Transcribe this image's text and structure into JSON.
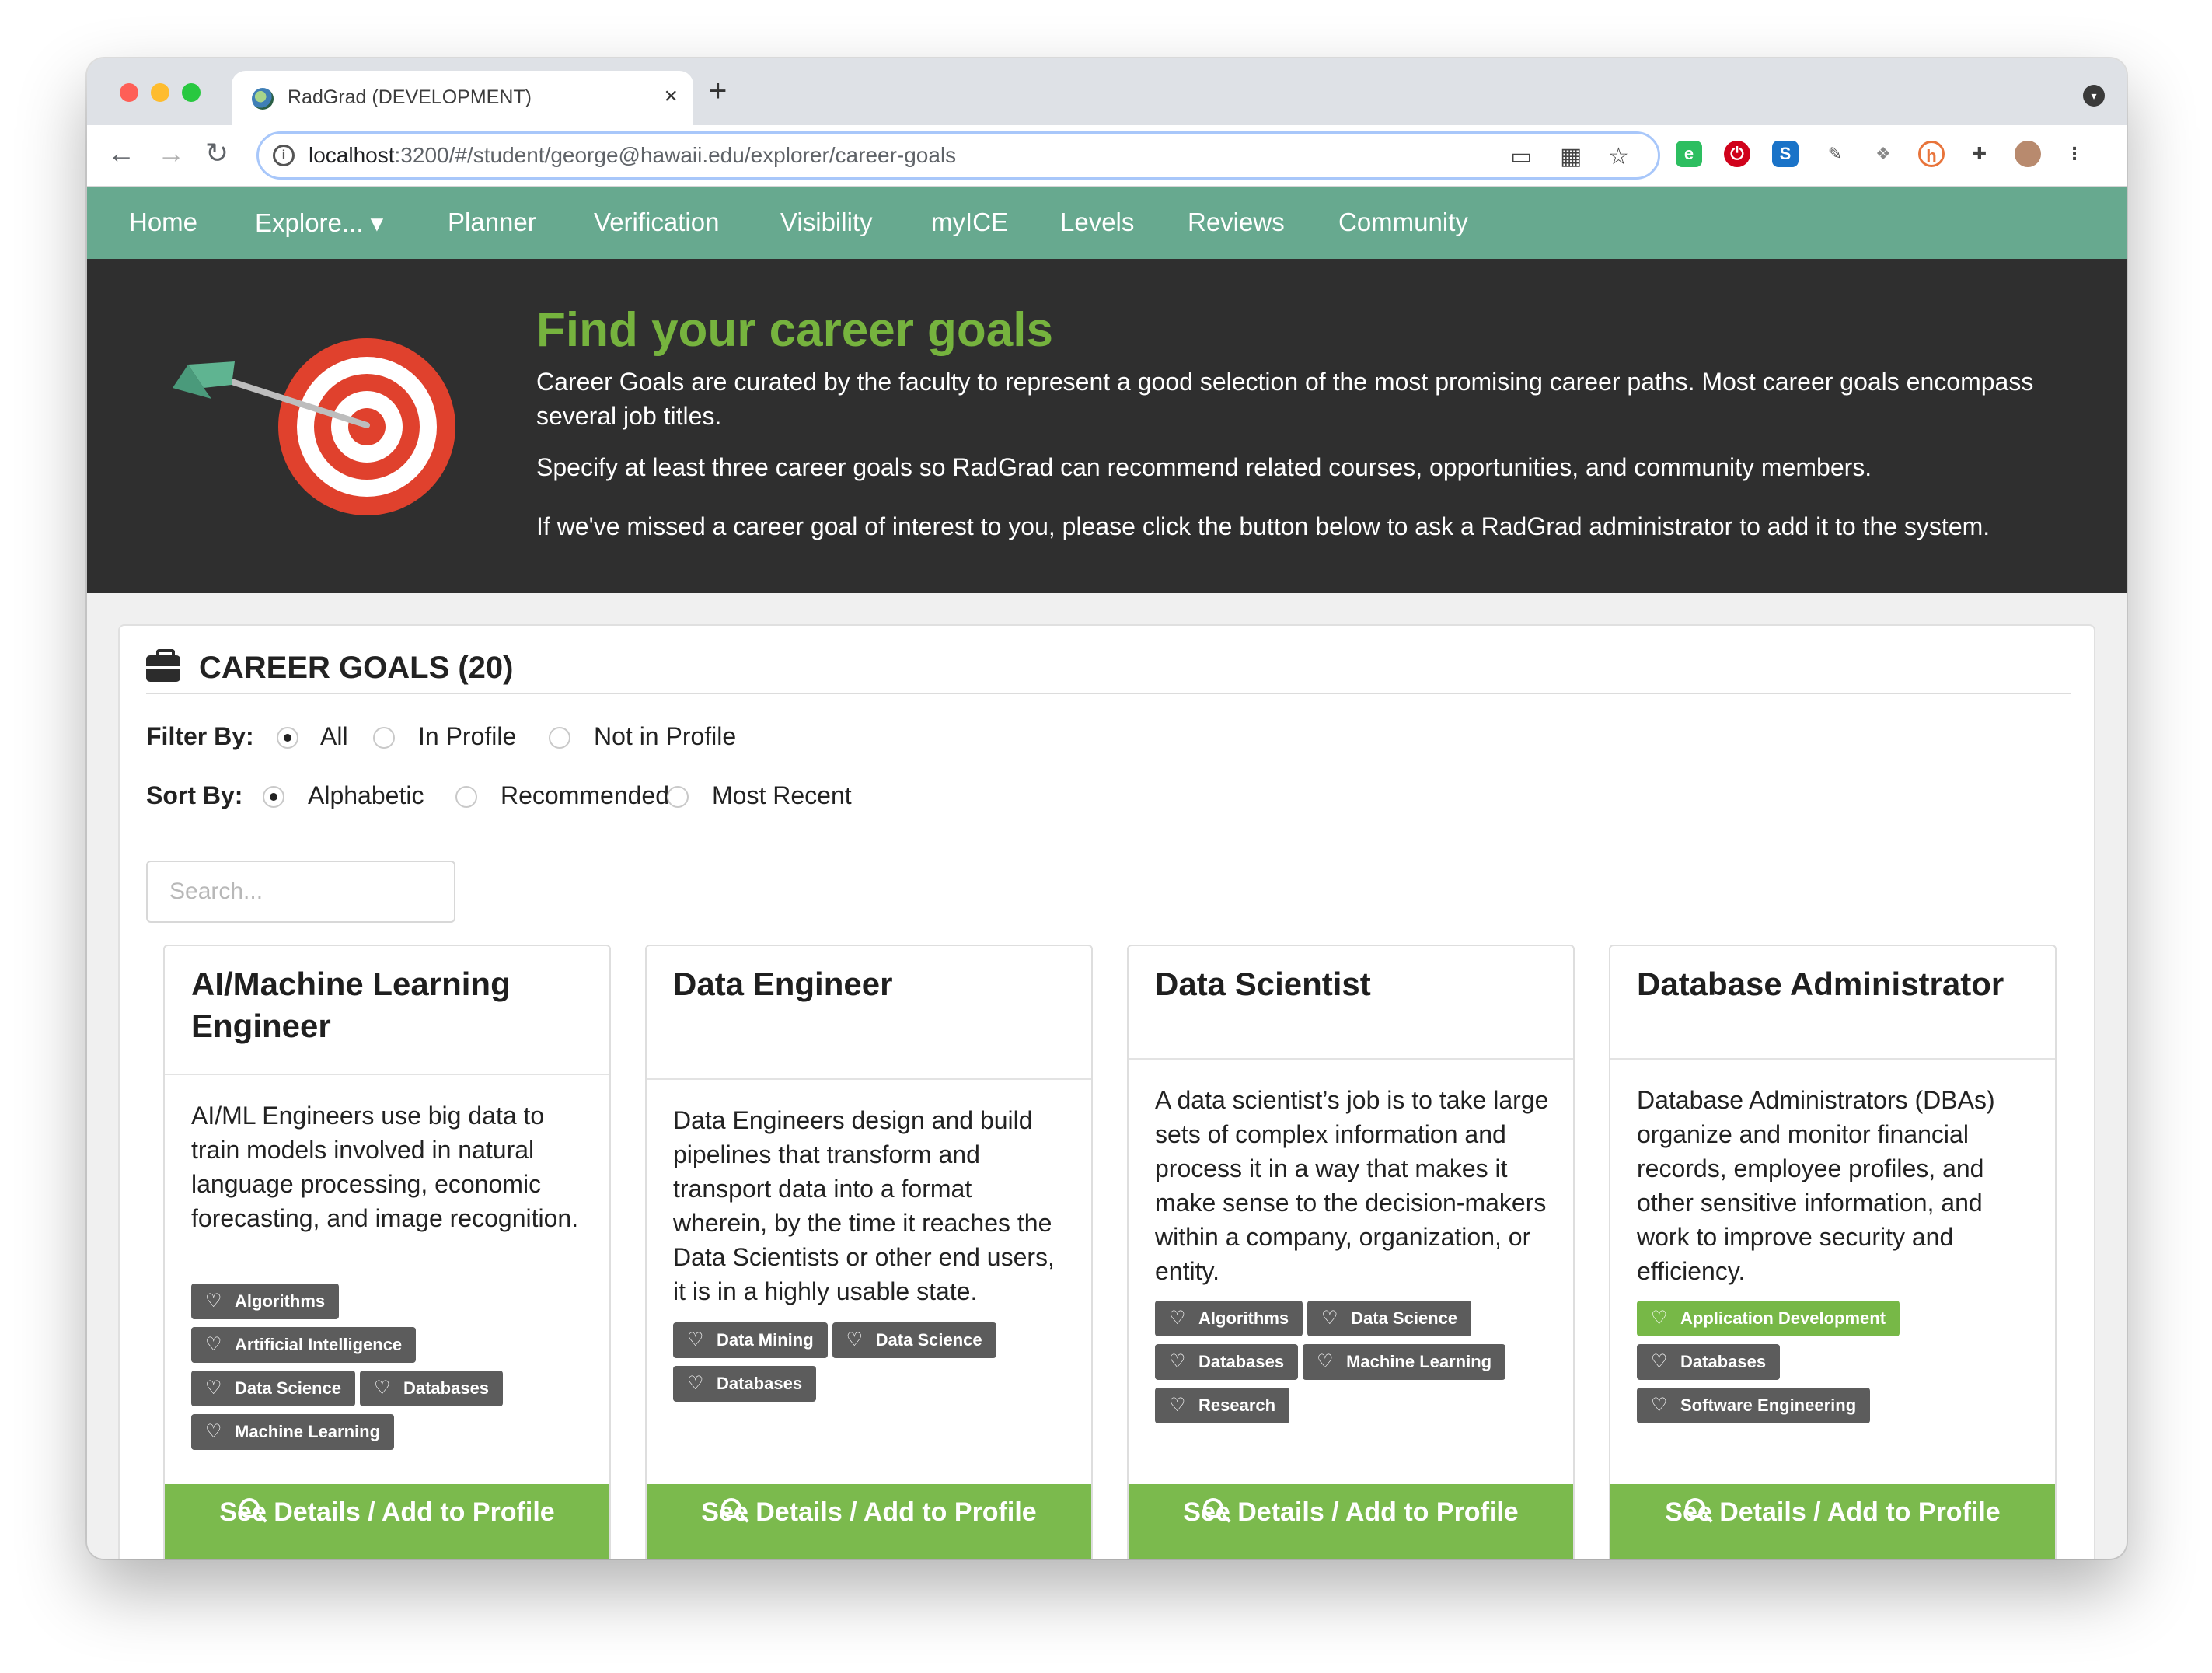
{
  "browser": {
    "tab_title": "RadGrad (DEVELOPMENT)",
    "tab_close": "×",
    "new_tab": "+",
    "url_host": "localhost",
    "url_rest": ":3200/#/student/george@hawaii.edu/explorer/career-goals"
  },
  "nav": {
    "items": [
      "Home",
      "Explore... ▾",
      "Planner",
      "Verification",
      "Visibility",
      "myICE",
      "Levels",
      "Reviews",
      "Community"
    ]
  },
  "hero": {
    "title": "Find your career goals",
    "p1": "Career Goals are curated by the faculty to represent a good selection of the most promising career paths. Most career goals encompass several job titles.",
    "p2": "Specify at least three career goals so RadGrad can recommend related courses, opportunities, and community members.",
    "p3": "If we've missed a career goal of interest to you, please click the button below to ask a RadGrad administrator to add it to the system."
  },
  "panel": {
    "title": "CAREER GOALS (20)",
    "filter_label": "Filter By:",
    "filter_options": [
      "All",
      "In Profile",
      "Not in Profile"
    ],
    "sort_label": "Sort By:",
    "sort_options": [
      "Alphabetic",
      "Recommended",
      "Most Recent"
    ],
    "search_placeholder": "Search..."
  },
  "cards": [
    {
      "title": "AI/Machine Learning Engineer",
      "description": "AI/ML Engineers use big data to train models involved in natural language processing, economic forecasting, and image recognition.",
      "tags": [
        "Algorithms",
        "Artificial Intelligence",
        "Data Science",
        "Databases",
        "Machine Learning"
      ],
      "button": "See Details / Add to Profile"
    },
    {
      "title": "Data Engineer",
      "description": "Data Engineers design and build pipelines that transform and transport data into a format wherein, by the time it reaches the Data Scientists or other end users, it is in a highly usable state.",
      "tags": [
        "Data Mining",
        "Data Science",
        "Databases"
      ],
      "button": "See Details / Add to Profile"
    },
    {
      "title": "Data Scientist",
      "description": "A data scientist’s job is to take large sets of complex information and process it in a way that makes it make sense to the decision-makers within a company, organization, or entity.",
      "tags": [
        "Algorithms",
        "Data Science",
        "Databases",
        "Machine Learning",
        "Research"
      ],
      "button": "See Details / Add to Profile"
    },
    {
      "title": "Database Administrator",
      "description": "Database Administrators (DBAs) organize and monitor financial records, employee profiles, and other sensitive information, and work to improve security and efficiency.",
      "tags": [
        "Application Development",
        "Databases",
        "Software Engineering"
      ],
      "highlighted_tag": "Application Development",
      "button": "See Details / Add to Profile"
    }
  ],
  "colors": {
    "nav_green": "#67a98f",
    "hero_bg": "#2f2f2f",
    "title_green": "#76b33e",
    "button_green": "#7bba4d",
    "tag_gray": "#5c5c5c"
  }
}
